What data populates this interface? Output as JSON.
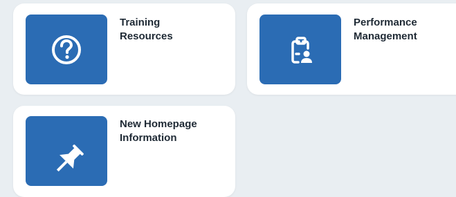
{
  "tiles": [
    {
      "line1": "Training",
      "line2": "Resources",
      "icon": "question-circle-icon"
    },
    {
      "line1": "Performance",
      "line2": "Management",
      "icon": "clipboard-person-icon"
    },
    {
      "line1": "New Homepage",
      "line2": "Information",
      "icon": "pin-icon"
    }
  ],
  "colors": {
    "background": "#e9eef2",
    "tile": "#ffffff",
    "icon_box": "#2b6cb4",
    "label_text": "#1f2a35"
  }
}
